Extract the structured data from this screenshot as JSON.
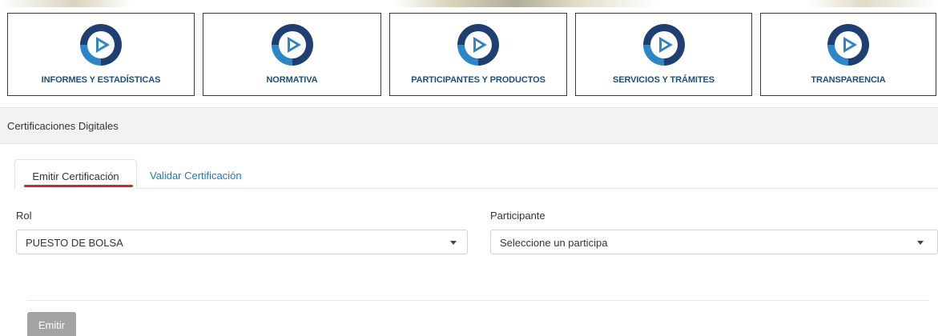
{
  "tiles": [
    {
      "label": "INFORMES Y ESTADÍSTICAS"
    },
    {
      "label": "NORMATIVA"
    },
    {
      "label": "PARTICIPANTES Y PRODUCTOS"
    },
    {
      "label": "SERVICIOS Y TRÁMITES"
    },
    {
      "label": "TRANSPARENCIA"
    }
  ],
  "section": {
    "title": "Certificaciones Digitales"
  },
  "tabs": [
    {
      "label": "Emitir Certificación",
      "active": true
    },
    {
      "label": "Validar Certificación",
      "active": false
    }
  ],
  "form": {
    "rol": {
      "label": "Rol",
      "value": "PUESTO DE BOLSA"
    },
    "participante": {
      "label": "Participante",
      "value": "Seleccione un participa"
    }
  },
  "actions": {
    "emit_label": "Emitir"
  },
  "colors": {
    "tile_label": "#1f4e79",
    "logo_dark": "#1f3f73",
    "logo_light": "#2e86c9",
    "tab_link": "#1a7bbf",
    "tab_underline": "#d9251c",
    "button_disabled": "#a3a3a3"
  },
  "icons": {
    "tile_logo": "circular-arrows-play-logo",
    "dropdown": "caret-down-icon"
  }
}
